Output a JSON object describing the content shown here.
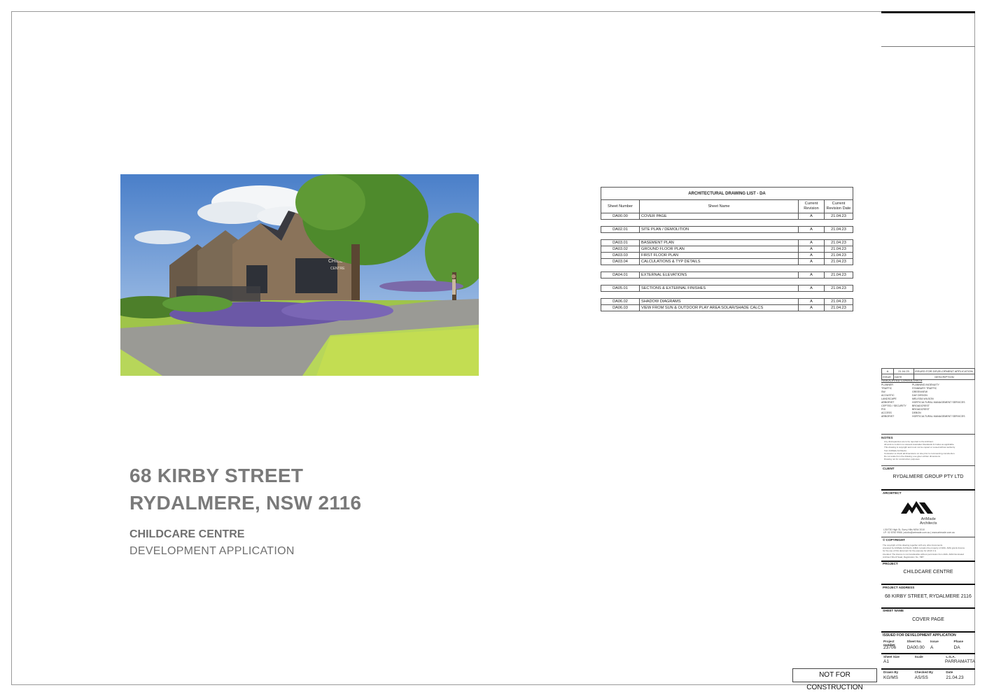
{
  "address": {
    "line1": "68 KIRBY STREET",
    "line2": "RYDALMERE, NSW 2116",
    "project_type": "CHILDCARE CENTRE",
    "phase": "DEVELOPMENT APPLICATION"
  },
  "rendering": {
    "sign_text_1": "CHILDCARE",
    "sign_text_2": "CENTRE"
  },
  "drawing_list": {
    "title": "ARCHITECTURAL DRAWING LIST - DA",
    "headers": [
      "Sheet Number",
      "Sheet Name",
      "Current Revision",
      "Current Revision Date"
    ],
    "groups": [
      [
        [
          "DA00.00",
          "COVER PAGE",
          "A",
          "21.04.23"
        ]
      ],
      [
        [
          "DA02.01",
          "SITE PLAN / DEMOLITION",
          "A",
          "21.04.23"
        ]
      ],
      [
        [
          "DA03.01",
          "BASEMENT PLAN",
          "A",
          "21.04.23"
        ],
        [
          "DA03.02",
          "GROUND FLOOR PLAN",
          "A",
          "21.04.23"
        ],
        [
          "DA03.03",
          "FIRST FLOOR PLAN",
          "A",
          "21.04.23"
        ],
        [
          "DA03.04",
          "CALCULATIONS & TYP DETAILS",
          "A",
          "21.04.23"
        ]
      ],
      [
        [
          "DA04.01",
          "EXTERNAL ELEVATIONS",
          "A",
          "21.04.23"
        ]
      ],
      [
        [
          "DA05.01",
          "SECTIONS & EXTERNAL FINISHES",
          "A",
          "21.04.23"
        ]
      ],
      [
        [
          "DA06.02",
          "SHADOW DIAGRAMS",
          "A",
          "21.04.23"
        ],
        [
          "DA06.03",
          "VIEW FROM SUN & OUTDOOR PLAY AREA SOLAR/SHADE CALCS",
          "A",
          "21.04.23"
        ]
      ]
    ]
  },
  "title_block": {
    "revision": {
      "issue": "A",
      "date": "21.04.23",
      "description": "ISSUED FOR DEVELOPMENT APPLICATION",
      "h_issue": "ISSUE",
      "h_date": "DATE",
      "h_description": "DESCRIPTION"
    },
    "consultants_header": "ASSOCIATED CONSULTANTS",
    "consultants": [
      [
        "PLANNER",
        "PLANNING INGENUITY"
      ],
      [
        "TRAFFIC",
        "STANBURY TRAFFIC"
      ],
      [
        "SW",
        "GREENVIEW"
      ],
      [
        "ACOUSTIC",
        "DAY DESIGN"
      ],
      [
        "LANDSCAPE",
        "MELISSA WILSON"
      ],
      [
        "ARBORIST",
        "HORTICULTURAL MANAGEMENT SERVICES"
      ],
      [
        "CEPTED / SECURITY",
        "BROADCREST"
      ],
      [
        "POI",
        "BROADCREST"
      ],
      [
        "ACCESS",
        "DEBON"
      ],
      [
        "ARBORIST",
        "HORTICULTURAL MANAGEMENT SERVICES"
      ]
    ],
    "notes_header": "NOTES",
    "notes": [
      "Any discrepancies are to be reported to the Architect.",
      "All work to conform to relevant Australian Standards & Codes as applicable.",
      "This drawing is copyright and must not be copied or reused without authority",
      "from ArtMade Architects.",
      "Contractor to check all dimensions on site prior to commencing construction.",
      "Do not scale from the drawing; use given written dimensions.",
      "Drawing not for construction purposes."
    ],
    "client_label": "CLIENT",
    "client": "RYDALMERE GROUP PTY LTD",
    "architect_label": "ARCHITECT",
    "architect_name_1": "ArtMade",
    "architect_name_2": "Architects",
    "architect_address": "L30/730 High St, Surry Hills NSW 2010",
    "architect_contact": "LP: 02 8760 9966 | studio@artmade.com.au | www.artmade.com.au",
    "copyright_label": "© COPYRIGHT",
    "copyright_lines": [
      "The copyright of this drawing together with any other documents",
      "prepared by ArtMade Architects (AMA) remains the property of AMA. AMA grants licence",
      "for the use of this document for the purpose for which it is",
      "intended. The licence is not transferable without permission from AMA. AMA Nominated",
      "Architect Sherif Saad, Registration No. 7987"
    ],
    "project_label": "PROJECT",
    "project": "CHILDCARE CENTRE",
    "project_address_label": "PROJECT ADDRESS",
    "project_address": "68 KIRBY STREET, RYDALMERE 2116",
    "sheet_name_label": "SHEET NAME",
    "sheet_name": "COVER PAGE",
    "status": "ISSUED FOR DEVELOPMENT APPLICATION",
    "row1_labels": [
      "Project number",
      "Sheet No.",
      "Issue",
      "Phase"
    ],
    "row1_values": [
      "23706",
      "DA00.00",
      "A",
      "DA"
    ],
    "row2_labels": [
      "Sheet Size",
      "Scale",
      "L.G.A."
    ],
    "row2_values": [
      "A1",
      "",
      "PARRAMATTA"
    ],
    "row3_labels": [
      "Drawn By",
      "Checked By",
      "Date"
    ],
    "row3_values": [
      "KG/MS",
      "AS/SS",
      "21.04.23"
    ]
  },
  "stamp": "NOT FOR CONSTRUCTION"
}
